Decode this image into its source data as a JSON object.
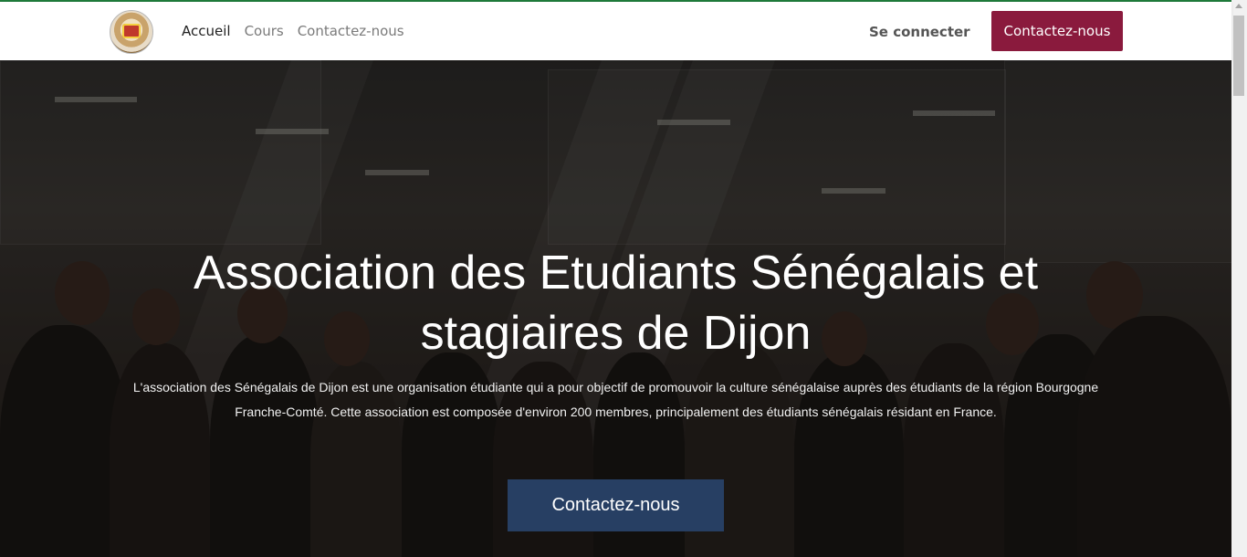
{
  "nav": {
    "links": [
      "Accueil",
      "Cours",
      "Contactez-nous"
    ],
    "login_label": "Se connecter",
    "cta_label": "Contactez-nous"
  },
  "hero": {
    "title": "Association des Etudiants Sénégalais et stagiaires de Dijon",
    "description": "L'association des Sénégalais de Dijon est une organisation étudiante qui a pour objectif de promouvoir la culture sénégalaise auprès des étudiants de la région Bourgogne Franche-Comté. Cette association est composée d'environ 200 membres, principalement des étudiants sénégalais résidant en France.",
    "cta_label": "Contactez-nous"
  },
  "colors": {
    "accent_top": "#1f7a3a",
    "nav_cta": "#8a1a3d",
    "hero_cta": "#273f63"
  },
  "icons": [
    "association-logo",
    "scroll-up-icon"
  ]
}
